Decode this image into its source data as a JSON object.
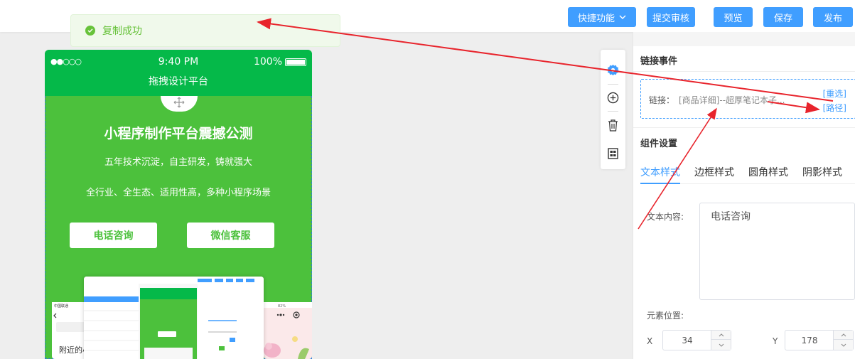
{
  "toolbar": {
    "quick_label": "快捷功能",
    "submit_label": "提交审核",
    "preview_label": "预览",
    "save_label": "保存",
    "publish_label": "发布"
  },
  "toast": {
    "message": "复制成功"
  },
  "phone": {
    "status_dots": "●●○○○",
    "time": "9:40 PM",
    "battery": "100%",
    "title": "拖拽设计平台",
    "hero_title": "小程序制作平台震撼公测",
    "hero_sub1": "五年技术沉淀，自主研发，铸就强大",
    "hero_sub2": "全行业、全生态、适用性高，多种小程序场景",
    "btn_phone": "电话咨询",
    "btn_wechat": "微信客服",
    "illus_left_text": "附近的小"
  },
  "panel": {
    "link_section": "链接事件",
    "link_label": "链接：",
    "link_value": "[商品详细]--超厚笔记本子...",
    "reselect": "[重选]",
    "path": "[路径]",
    "component_section": "组件设置",
    "tabs": [
      "文本样式",
      "边框样式",
      "圆角样式",
      "阴影样式"
    ],
    "text_label": "文本内容:",
    "text_value": "电话咨询",
    "position_label": "元素位置:",
    "x_label": "X",
    "x_value": "34",
    "y_label": "Y",
    "y_value": "178"
  },
  "colors": {
    "primary": "#409eff",
    "phone_green": "#4cc13c",
    "header_green": "#05b949",
    "toast_green": "#67c23a",
    "arrow_red": "#e8242c"
  }
}
